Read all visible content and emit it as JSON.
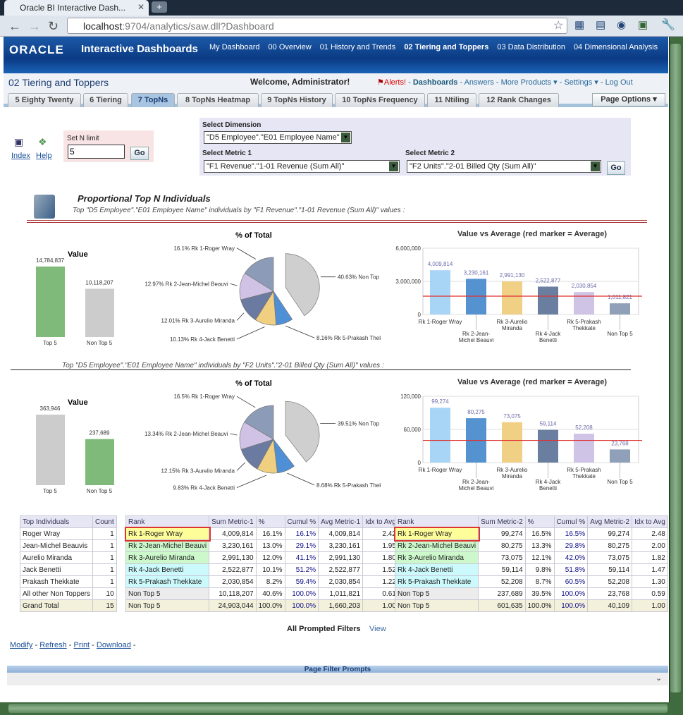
{
  "browser": {
    "tab_title": "Oracle BI Interactive Dash...",
    "url_host": "localhost",
    "url_rest": ":9704/analytics/saw.dll?Dashboard"
  },
  "header": {
    "logo": "ORACLE",
    "app": "Interactive Dashboards",
    "nav": [
      "My Dashboard",
      "00 Overview",
      "01 History and Trends",
      "02 Tiering and Toppers",
      "03 Data Distribution",
      "04 Dimensional Analysis"
    ]
  },
  "subheader": {
    "page_title": "02 Tiering and Toppers",
    "welcome": "Welcome, Administrator!",
    "alerts": "Alerts!",
    "dashboards": "Dashboards",
    "answers": "Answers",
    "more_products": "More Products",
    "settings": "Settings",
    "logout": "Log Out"
  },
  "tabs": [
    "5 Eighty Twenty",
    "6 Tiering",
    "7 TopNs",
    "8 TopNs Heatmap",
    "9 TopNs History",
    "10 TopNs Frequency",
    "11 Ntiling",
    "12 Rank Changes"
  ],
  "active_tab": "7 TopNs",
  "page_options": "Page Options",
  "prompts": {
    "index": "Index",
    "help": "Help",
    "n_limit_label": "Set N limit",
    "n_limit_value": "5",
    "go": "Go",
    "dimension_label": "Select Dimension",
    "dimension_value": "\"D5 Employee\".\"E01 Employee Name\"",
    "metric1_label": "Select Metric 1",
    "metric1_value": "\"F1 Revenue\".\"1-01 Revenue (Sum All)\"",
    "metric2_label": "Select Metric 2",
    "metric2_value": "\"F2 Units\".\"2-01 Billed Qty (Sum All)\""
  },
  "section": {
    "title": "Proportional Top N Individuals",
    "subtitle1": "Top \"D5 Employee\".\"E01 Employee Name\" individuals by \"F1 Revenue\".\"1-01 Revenue (Sum All)\" values :",
    "subtitle2": "Top \"D5 Employee\".\"E01 Employee Name\" individuals by \"F2 Units\".\"2-01 Billed Qty (Sum All)\" values :"
  },
  "colors": {
    "green": "#7fba7a",
    "gray": "#cccccc",
    "avg_line": "#e03030",
    "rk1": "#a8d4f5",
    "rk2": "#5593d0",
    "rk3": "#f0d085",
    "rk4": "#6a7fa0",
    "rk5": "#d0c4e6",
    "non": "#8fa0b8"
  },
  "chart_data": [
    {
      "type": "bar",
      "title": "Value",
      "categories": [
        "Top 5",
        "Non Top 5"
      ],
      "values": [
        14784837,
        10118207
      ],
      "colors": [
        "#7fba7a",
        "#cccccc"
      ]
    },
    {
      "type": "pie",
      "title": "% of Total",
      "categories": [
        "Non Top 5",
        "Rk 5-Prakash Thekkate",
        "Rk 4-Jack Benetti",
        "Rk 3-Aurelio Miranda",
        "Rk 2-Jean-Michel Beauvi",
        "Rk 1-Roger Wray"
      ],
      "values": [
        40.63,
        8.16,
        10.13,
        12.01,
        12.97,
        16.1
      ],
      "labels": [
        "40.63%",
        "8.16%",
        "10.13%",
        "12.01%",
        "12.97%",
        "16.1%"
      ],
      "colors": [
        "#cfcfcf",
        "#4f8fd6",
        "#f0d080",
        "#6a7aa0",
        "#d0c2e4",
        "#8c9cb8"
      ],
      "exploded": "Non Top 5"
    },
    {
      "type": "bar",
      "title": "Value vs Average (red marker = Average)",
      "categories": [
        "Rk 1-Roger Wray",
        "Rk 2-Jean-Michel Beauvi",
        "Rk 3-Aurelio Miranda",
        "Rk 4-Jack Benetti",
        "Rk 5-Prakash Thekkate",
        "Non Top 5"
      ],
      "values": [
        4009814,
        3230161,
        2991130,
        2522877,
        2030854,
        1011821
      ],
      "value_labels": [
        "4,009,814",
        "3,230,161",
        "2,991,130",
        "2,522,877",
        "2,030,854",
        "1,011,821"
      ],
      "average": 1660203,
      "ylim": [
        0,
        6000000
      ],
      "yticks": [
        "0",
        "3,000,000",
        "6,000,000"
      ],
      "ytick_values": [
        0,
        3000000,
        6000000
      ],
      "colors": [
        "#a8d4f5",
        "#5593d0",
        "#f0d085",
        "#6a7fa0",
        "#d0c4e6",
        "#8fa0b8"
      ],
      "grid": true
    },
    {
      "type": "bar",
      "title": "Value",
      "categories": [
        "Top 5",
        "Non Top 5"
      ],
      "values": [
        363946,
        237689
      ],
      "colors": [
        "#cccccc",
        "#7fba7a"
      ]
    },
    {
      "type": "pie",
      "title": "% of Total",
      "categories": [
        "Non Top 5",
        "Rk 5-Prakash Thekkate",
        "Rk 4-Jack Benetti",
        "Rk 3-Aurelio Miranda",
        "Rk 2-Jean-Michel Beauvi",
        "Rk 1-Roger Wray"
      ],
      "values": [
        39.51,
        8.68,
        9.83,
        12.15,
        13.34,
        16.5
      ],
      "labels": [
        "39.51%",
        "8.68%",
        "9.83%",
        "12.15%",
        "13.34%",
        "16.5%"
      ],
      "colors": [
        "#cfcfcf",
        "#4f8fd6",
        "#f0d080",
        "#6a7aa0",
        "#d0c2e4",
        "#8c9cb8"
      ],
      "exploded": "Non Top 5"
    },
    {
      "type": "bar",
      "title": "Value vs Average (red marker = Average)",
      "categories": [
        "Rk 1-Roger Wray",
        "Rk 2-Jean-Michel Beauvi",
        "Rk 3-Aurelio Miranda",
        "Rk 4-Jack Benetti",
        "Rk 5-Prakash Thekkate",
        "Non Top 5"
      ],
      "values": [
        99274,
        80275,
        73075,
        59114,
        52208,
        23768
      ],
      "value_labels": [
        "99,274",
        "80,275",
        "73,075",
        "59,114",
        "52,208",
        "23,768"
      ],
      "average": 40109,
      "ylim": [
        0,
        120000
      ],
      "yticks": [
        "0",
        "60,000",
        "120,000"
      ],
      "ytick_values": [
        0,
        60000,
        120000
      ],
      "colors": [
        "#a8d4f5",
        "#5593d0",
        "#f0d085",
        "#6a7fa0",
        "#d0c4e6",
        "#8fa0b8"
      ],
      "grid": true
    }
  ],
  "table_individuals": {
    "headers": [
      "Top Individuals",
      "Count"
    ],
    "rows": [
      [
        "Roger Wray",
        "1"
      ],
      [
        "Jean-Michel Beauvis",
        "1"
      ],
      [
        "Aurelio Miranda",
        "1"
      ],
      [
        "Jack Benetti",
        "1"
      ],
      [
        "Prakash Thekkate",
        "1"
      ],
      [
        "All other Non Toppers",
        "10"
      ]
    ],
    "total": [
      "Grand Total",
      "15"
    ]
  },
  "table_metric1": {
    "headers": [
      "Rank",
      "Sum Metric-1",
      "%",
      "Cumul %",
      "Avg Metric-1",
      "Idx to Avg"
    ],
    "rows": [
      [
        "Rk 1-Roger Wray",
        "4,009,814",
        "16.1%",
        "16.1%",
        "4,009,814",
        "2.42"
      ],
      [
        "Rk 2-Jean-Michel Beauvi",
        "3,230,161",
        "13.0%",
        "29.1%",
        "3,230,161",
        "1.95"
      ],
      [
        "Rk 3-Aurelio Miranda",
        "2,991,130",
        "12.0%",
        "41.1%",
        "2,991,130",
        "1.80"
      ],
      [
        "Rk 4-Jack Benetti",
        "2,522,877",
        "10.1%",
        "51.2%",
        "2,522,877",
        "1.52"
      ],
      [
        "Rk 5-Prakash Thekkate",
        "2,030,854",
        "8.2%",
        "59.4%",
        "2,030,854",
        "1.22"
      ],
      [
        "Non Top 5",
        "10,118,207",
        "40.6%",
        "100.0%",
        "1,011,821",
        "0.61"
      ]
    ],
    "total": [
      "Non Top 5",
      "24,903,044",
      "100.0%",
      "100.0%",
      "1,660,203",
      "1.00"
    ]
  },
  "table_metric2": {
    "headers": [
      "Rank",
      "Sum Metric-2",
      "%",
      "Cumul %",
      "Avg Metric-2",
      "Idx to Avg"
    ],
    "rows": [
      [
        "Rk 1-Roger Wray",
        "99,274",
        "16.5%",
        "16.5%",
        "99,274",
        "2.48"
      ],
      [
        "Rk 2-Jean-Michel Beauvi",
        "80,275",
        "13.3%",
        "29.8%",
        "80,275",
        "2.00"
      ],
      [
        "Rk 3-Aurelio Miranda",
        "73,075",
        "12.1%",
        "42.0%",
        "73,075",
        "1.82"
      ],
      [
        "Rk 4-Jack Benetti",
        "59,114",
        "9.8%",
        "51.8%",
        "59,114",
        "1.47"
      ],
      [
        "Rk 5-Prakash Thekkate",
        "52,208",
        "8.7%",
        "60.5%",
        "52,208",
        "1.30"
      ],
      [
        "Non Top 5",
        "237,689",
        "39.5%",
        "100.0%",
        "23,768",
        "0.59"
      ]
    ],
    "total": [
      "Non Top 5",
      "601,635",
      "100.0%",
      "100.0%",
      "40,109",
      "1.00"
    ]
  },
  "rank_colors": [
    "#fdfd99",
    "#ccf8cc",
    "#ccf8cc",
    "#ccfafc",
    "#ccfafc",
    "#ececec"
  ],
  "filters": {
    "label": "All Prompted Filters",
    "view": "View"
  },
  "footer_links": [
    "Modify",
    "Refresh",
    "Print",
    "Download"
  ],
  "page_filter_prompts": "Page Filter Prompts"
}
